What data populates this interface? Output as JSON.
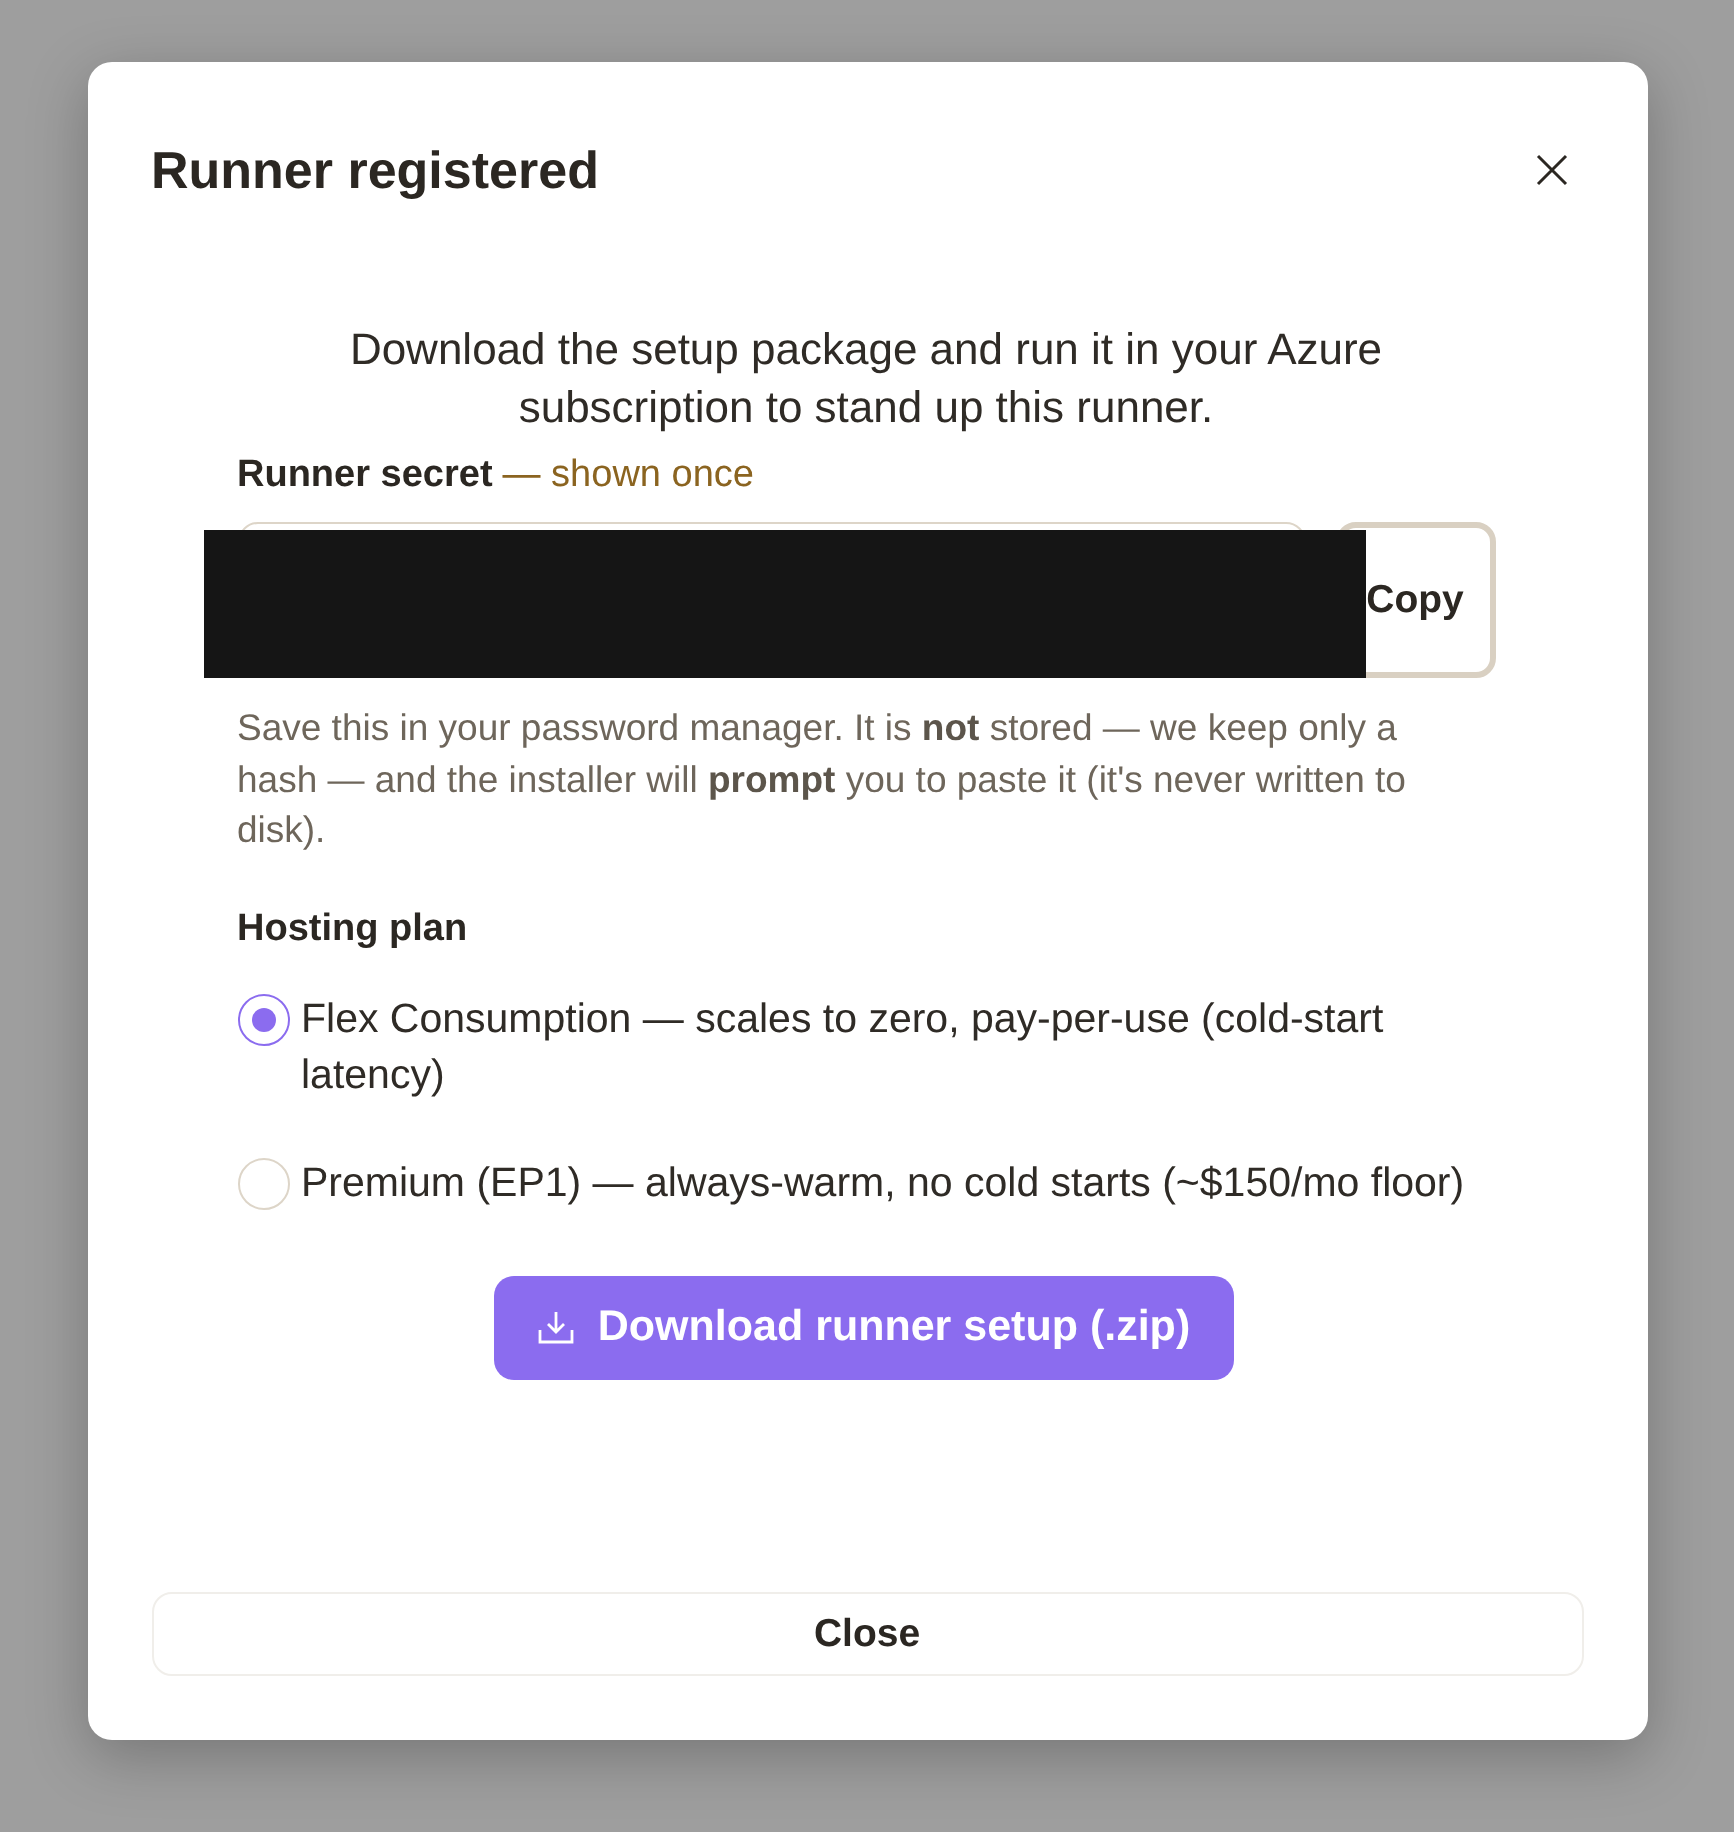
{
  "dialog": {
    "title": "Runner registered"
  },
  "intro": "Download the setup package and run it in your Azure subscription to stand up this runner.",
  "secret": {
    "label": "Runner secret",
    "note": "— shown once",
    "redacted": true,
    "copy_button": "Copy",
    "hint": "Save this in your password manager. It is **not** stored — we keep only a hash — and the installer will **prompt** you to paste it (it's never written to disk)."
  },
  "hosting_plan": {
    "label": "Hosting plan",
    "options": [
      {
        "label": "Flex Consumption — scales to zero, pay-per-use (cold-start latency)",
        "selected": true
      },
      {
        "label": "Premium (EP1) — always-warm, no cold starts (~$150/mo floor)",
        "selected": false
      }
    ]
  },
  "download_button": "Download runner setup (.zip)",
  "footer": {
    "close_button": "Close"
  }
}
